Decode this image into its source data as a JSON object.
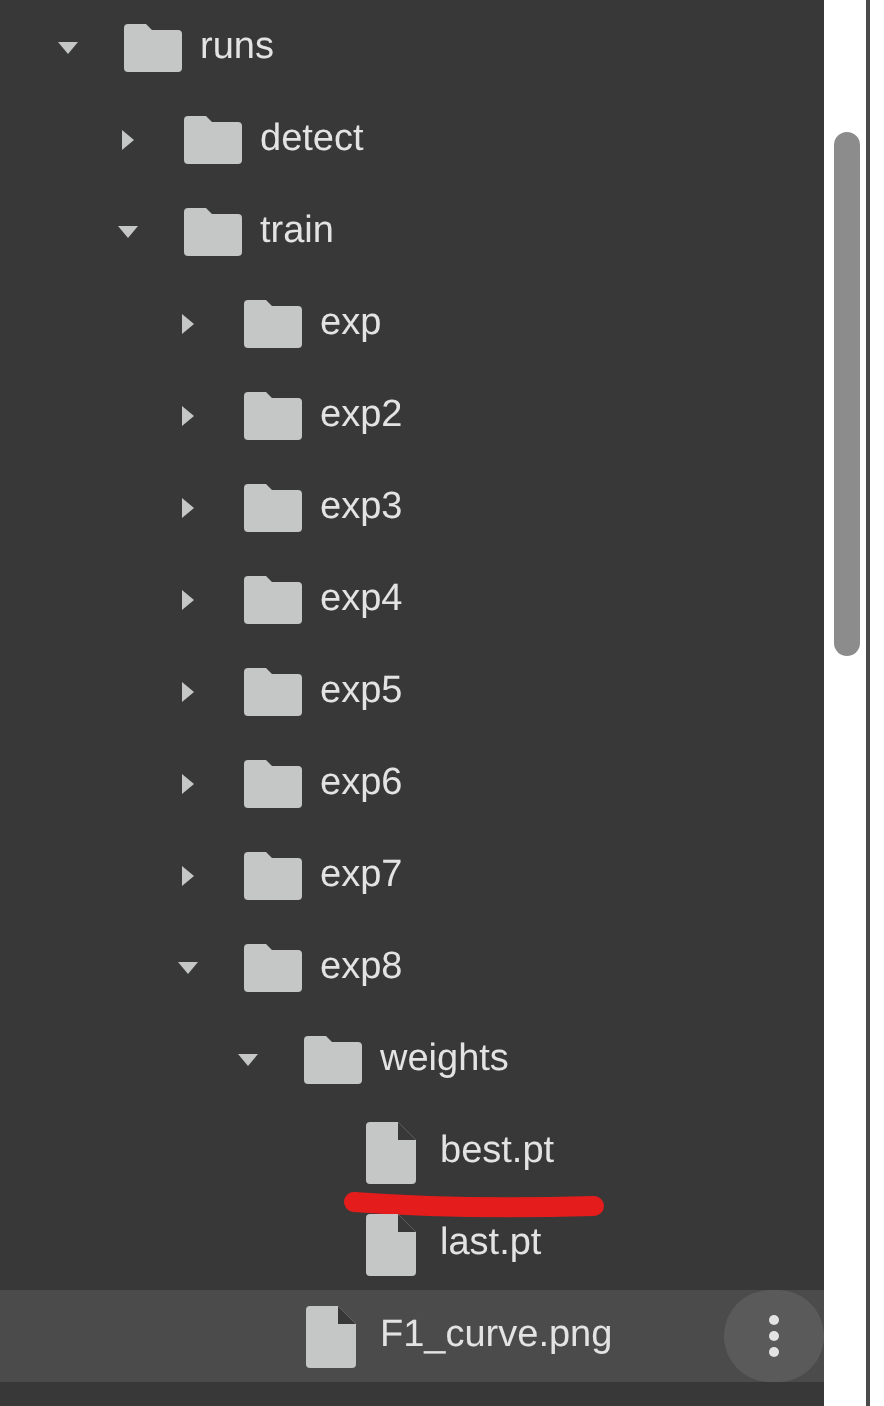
{
  "tree": [
    {
      "kind": "folder",
      "name": "runs",
      "expanded": true,
      "hovered": false,
      "children": [
        {
          "kind": "folder",
          "name": "detect",
          "expanded": false,
          "hovered": false
        },
        {
          "kind": "folder",
          "name": "train",
          "expanded": true,
          "hovered": false,
          "children": [
            {
              "kind": "folder",
              "name": "exp",
              "expanded": false,
              "hovered": false
            },
            {
              "kind": "folder",
              "name": "exp2",
              "expanded": false,
              "hovered": false
            },
            {
              "kind": "folder",
              "name": "exp3",
              "expanded": false,
              "hovered": false
            },
            {
              "kind": "folder",
              "name": "exp4",
              "expanded": false,
              "hovered": false
            },
            {
              "kind": "folder",
              "name": "exp5",
              "expanded": false,
              "hovered": false
            },
            {
              "kind": "folder",
              "name": "exp6",
              "expanded": false,
              "hovered": false
            },
            {
              "kind": "folder",
              "name": "exp7",
              "expanded": false,
              "hovered": false
            },
            {
              "kind": "folder",
              "name": "exp8",
              "expanded": true,
              "hovered": false,
              "children": [
                {
                  "kind": "folder",
                  "name": "weights",
                  "expanded": true,
                  "hovered": false,
                  "children": [
                    {
                      "kind": "file",
                      "name": "best.pt",
                      "underlined": true,
                      "hovered": false
                    },
                    {
                      "kind": "file",
                      "name": "last.pt",
                      "underlined": false,
                      "hovered": false
                    }
                  ]
                },
                {
                  "kind": "file",
                  "name": "F1_curve.png",
                  "underlined": false,
                  "hovered": true
                }
              ]
            }
          ]
        }
      ]
    }
  ]
}
